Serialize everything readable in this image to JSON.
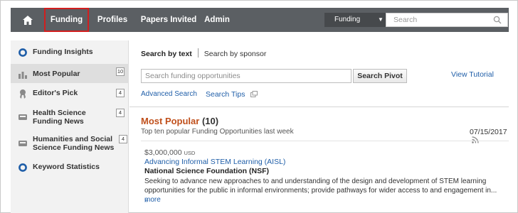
{
  "nav": {
    "items": [
      {
        "label": "Funding"
      },
      {
        "label": "Profiles"
      },
      {
        "label": "Papers Invited"
      },
      {
        "label": "Admin"
      }
    ],
    "search_scope": "Funding",
    "search_placeholder": "Search",
    "icons": {
      "home": "home-icon",
      "dropdown": "caret-down-icon",
      "search": "search-icon"
    }
  },
  "sidebar": {
    "items": [
      {
        "label": "Funding Insights",
        "icon": "circle-icon"
      },
      {
        "label": "Most Popular",
        "icon": "bar-chart-icon",
        "count": "10"
      },
      {
        "label": "Editor's Pick",
        "icon": "ribbon-icon",
        "count": "4"
      },
      {
        "label_lines": [
          "Health Science",
          "Funding News"
        ],
        "icon": "news-icon",
        "count": "4"
      },
      {
        "label_lines": [
          "Humanities and Social",
          "Science Funding News"
        ],
        "icon": "news-icon",
        "count": "4"
      },
      {
        "label": "Keyword Statistics",
        "icon": "circle-icon"
      }
    ]
  },
  "main": {
    "tabs": [
      "Search by text",
      "Search by sponsor"
    ],
    "search_placeholder": "Search funding opportunities",
    "search_button": "Search Pivot",
    "view_tutorial": "View Tutorial",
    "advanced_search": "Advanced Search",
    "search_tips": "Search Tips",
    "section_title": "Most Popular",
    "section_count": "(10)",
    "section_subtitle": "Top ten popular Funding Opportunities last week",
    "section_date": "07/15/2017",
    "result": {
      "amount": "$3,000,000",
      "currency": "USD",
      "title": "Advancing Informal STEM Learning (AISL)",
      "sponsor": "National Science Foundation (NSF)",
      "description_line1": "Seeking to advance new approaches to and understanding of the design and development of STEM learning",
      "description_line2": "opportunities for the public in informal environments; provide pathways for wider access to and engagement in...",
      "more": "more",
      "raquo": "»"
    }
  },
  "colors": {
    "nav_bg": "#5b5f63",
    "active_border": "#d11e1e",
    "link": "#1f5ea8",
    "section_title": "#c0501c",
    "sidebar_bg": "#f2f2f2",
    "sidebar_selected": "#dedede"
  }
}
